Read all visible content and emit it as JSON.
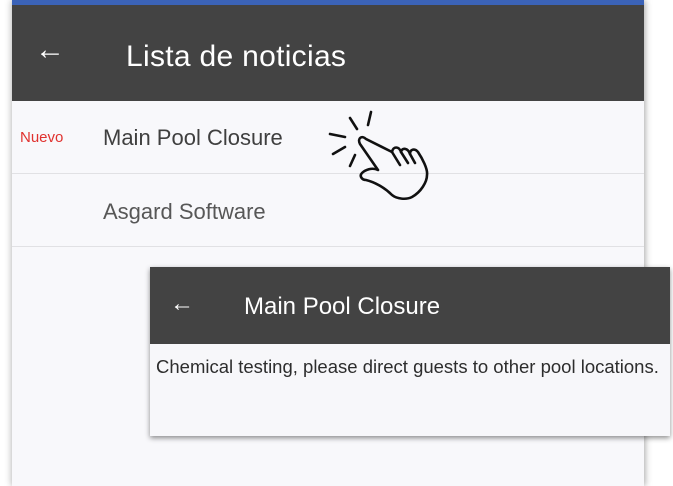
{
  "app": {
    "title": "Lista de noticias",
    "back_icon": "arrow-left-icon",
    "accent_color": "#3b63b8",
    "appbar_color": "#434343"
  },
  "news_list": [
    {
      "badge": "Nuevo",
      "title": "Main Pool Closure"
    },
    {
      "badge": "",
      "title": "Asgard Software"
    }
  ],
  "detail": {
    "title": "Main Pool Closure",
    "back_icon": "arrow-left-icon",
    "body": "Chemical testing, please direct guests to other pool locations."
  },
  "badge_color": "#e0322f",
  "gesture_icon": "tap-hand-icon"
}
